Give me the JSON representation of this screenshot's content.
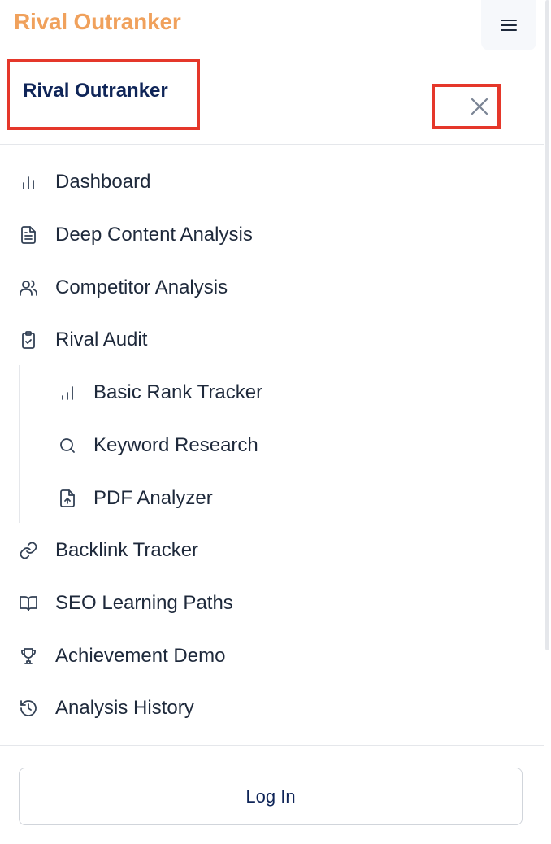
{
  "topbar": {
    "brand": "Rival Outranker",
    "menu_icon": "hamburger-menu-icon"
  },
  "drawer": {
    "title": "Rival Outranker",
    "close_icon": "close-icon"
  },
  "nav": {
    "items": [
      {
        "label": "Dashboard",
        "icon": "bar-chart-icon"
      },
      {
        "label": "Deep Content Analysis",
        "icon": "document-icon"
      },
      {
        "label": "Competitor Analysis",
        "icon": "users-icon"
      },
      {
        "label": "Rival Audit",
        "icon": "clipboard-check-icon"
      }
    ],
    "sub_items": [
      {
        "label": "Basic Rank Tracker",
        "icon": "signal-bars-icon"
      },
      {
        "label": "Keyword Research",
        "icon": "search-icon"
      },
      {
        "label": "PDF Analyzer",
        "icon": "file-upload-icon"
      }
    ],
    "more_items": [
      {
        "label": "Backlink Tracker",
        "icon": "link-icon"
      },
      {
        "label": "SEO Learning Paths",
        "icon": "book-open-icon"
      },
      {
        "label": "Achievement Demo",
        "icon": "trophy-icon"
      },
      {
        "label": "Analysis History",
        "icon": "history-icon"
      }
    ]
  },
  "footer": {
    "login_label": "Log In"
  },
  "colors": {
    "brand_accent": "#f0a15c",
    "title_navy": "#0f2558",
    "highlight_red": "#e5372a",
    "icon_slate": "#334155"
  }
}
